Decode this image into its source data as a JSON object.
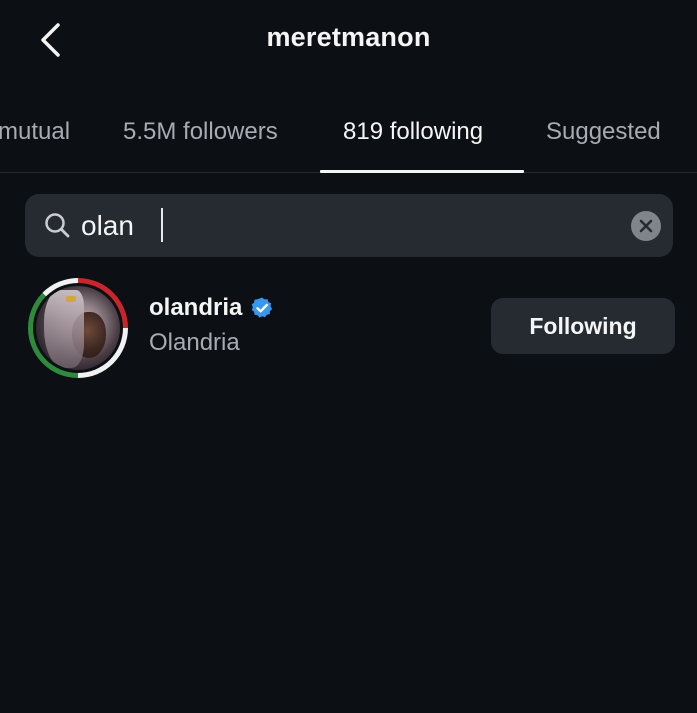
{
  "header": {
    "title": "meretmanon",
    "back_icon": "chevron-left-icon"
  },
  "tabs": [
    {
      "label": "mutual",
      "active": false
    },
    {
      "label": "5.5M followers",
      "active": false
    },
    {
      "label": "819 following",
      "active": true
    },
    {
      "label": "Suggested",
      "active": false
    }
  ],
  "search": {
    "value": "olan",
    "search_icon": "search-icon",
    "clear_icon": "clear-icon"
  },
  "results": [
    {
      "username": "olandria",
      "full_name": "Olandria",
      "verified": true,
      "verified_color": "#3897f0",
      "button_label": "Following"
    }
  ],
  "colors": {
    "background": "#0c0f14",
    "surface": "#262a31",
    "text_primary": "#f5f5f5",
    "text_secondary": "#a8abb2"
  }
}
